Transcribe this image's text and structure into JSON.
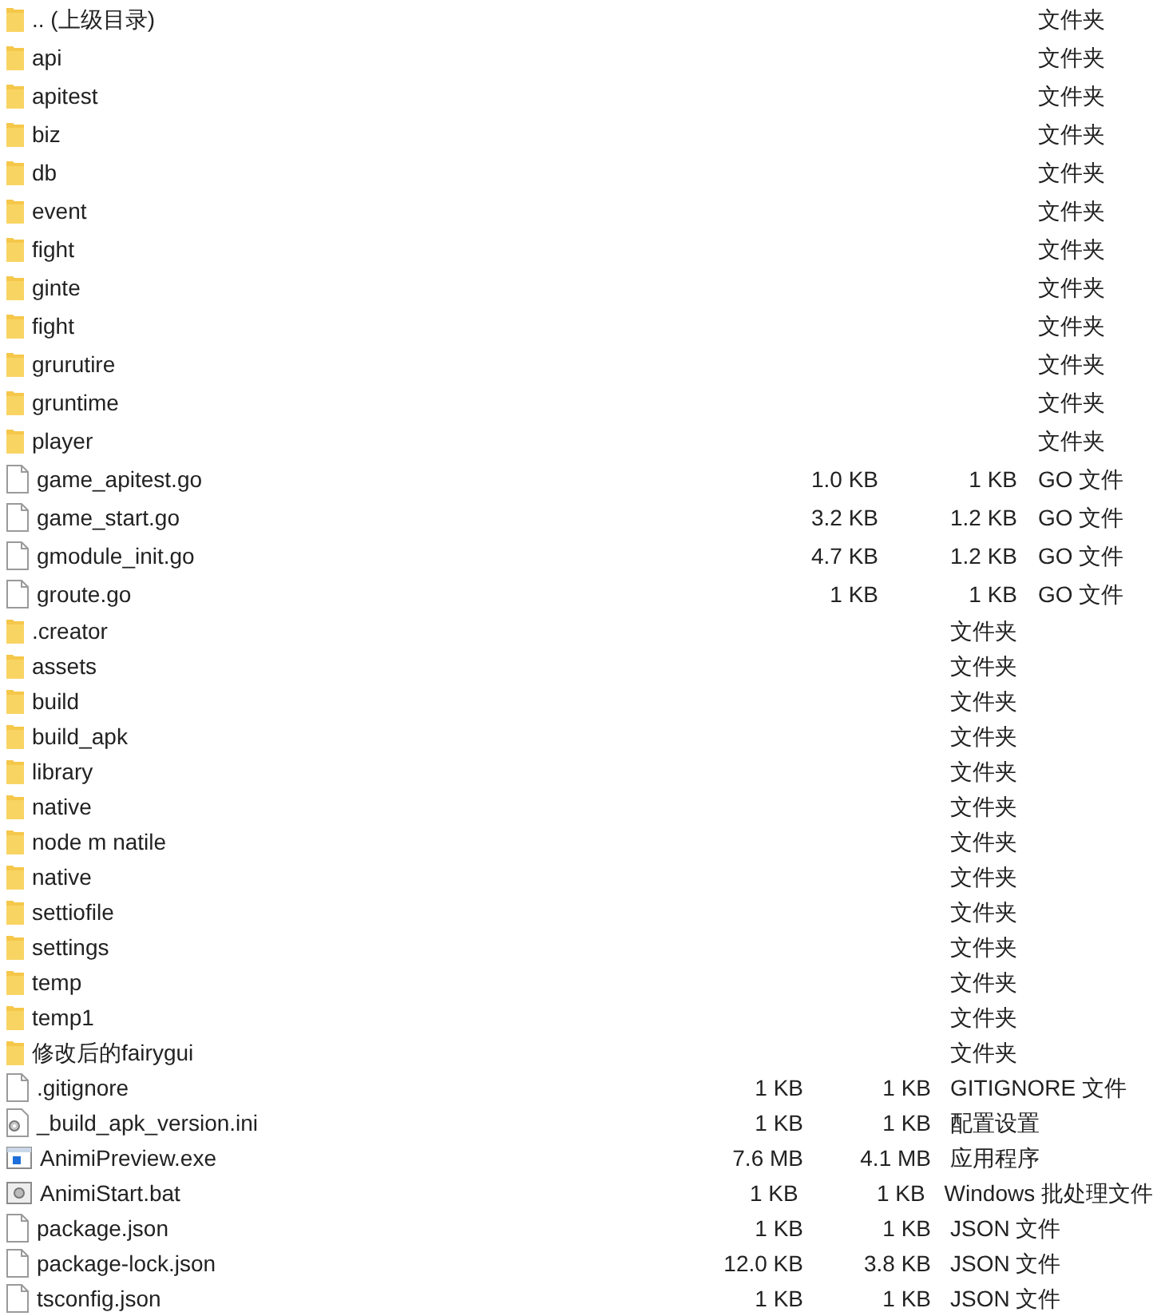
{
  "listings": [
    {
      "rows": [
        {
          "kind": "folder",
          "name": ".. (上级目录)",
          "size": "",
          "packed": "",
          "type": "文件夹"
        },
        {
          "kind": "folder",
          "name": "api",
          "type": "文件夹"
        },
        {
          "kind": "folder",
          "name": "apitest",
          "type": "文件夹"
        },
        {
          "kind": "folder",
          "name": "biz",
          "type": "文件夹"
        },
        {
          "kind": "folder",
          "name": "db",
          "type": "文件夹"
        },
        {
          "kind": "folder",
          "name": "event",
          "type": "文件夹"
        },
        {
          "kind": "folder",
          "name": "fight",
          "type": "文件夹"
        },
        {
          "kind": "folder",
          "name": "ginte",
          "type": "文件夹"
        },
        {
          "kind": "folder",
          "name": "fight",
          "type": "文件夹"
        },
        {
          "kind": "folder",
          "name": "grurutire",
          "type": "文件夹"
        },
        {
          "kind": "folder",
          "name": "gruntime",
          "type": "文件夹"
        },
        {
          "kind": "folder",
          "name": "player",
          "type": "文件夹"
        },
        {
          "kind": "file",
          "name": "game_apitest.go",
          "size": "1.0 KB",
          "packed": "1 KB",
          "type": "GO 文件"
        },
        {
          "kind": "file",
          "name": "game_start.go",
          "size": "3.2 KB",
          "packed": "1.2 KB",
          "type": "GO 文件"
        },
        {
          "kind": "file",
          "name": "gmodule_init.go",
          "size": "4.7 KB",
          "packed": "1.2 KB",
          "type": "GO 文件"
        },
        {
          "kind": "file",
          "name": "groute.go",
          "size": "1 KB",
          "packed": "1 KB",
          "type": "GO 文件"
        }
      ]
    },
    {
      "rows": [
        {
          "kind": "folder",
          "name": ".creator",
          "type": "文件夹"
        },
        {
          "kind": "folder",
          "name": "assets",
          "type": "文件夹"
        },
        {
          "kind": "folder",
          "name": "build",
          "type": "文件夹"
        },
        {
          "kind": "folder",
          "name": "build_apk",
          "type": "文件夹"
        },
        {
          "kind": "folder",
          "name": "library",
          "type": "文件夹"
        },
        {
          "kind": "folder",
          "name": "native",
          "type": "文件夹"
        },
        {
          "kind": "folder",
          "name": "node m natile",
          "type": "文件夹"
        },
        {
          "kind": "folder",
          "name": "native",
          "type": "文件夹"
        },
        {
          "kind": "folder",
          "name": "settiofile",
          "type": "文件夹"
        },
        {
          "kind": "folder",
          "name": "settings",
          "type": "文件夹"
        },
        {
          "kind": "folder",
          "name": "temp",
          "type": "文件夹"
        },
        {
          "kind": "folder",
          "name": "temp1",
          "type": "文件夹"
        },
        {
          "kind": "folder",
          "name": "修改后的fairygui",
          "type": "文件夹"
        },
        {
          "kind": "file",
          "name": ".gitignore",
          "size": "1 KB",
          "packed": "1 KB",
          "type": "GITIGNORE 文件"
        },
        {
          "kind": "ini",
          "name": "_build_apk_version.ini",
          "size": "1 KB",
          "packed": "1 KB",
          "type": "配置设置"
        },
        {
          "kind": "exe",
          "name": "AnimiPreview.exe",
          "size": "7.6 MB",
          "packed": "4.1 MB",
          "type": "应用程序"
        },
        {
          "kind": "bat",
          "name": "AnimiStart.bat",
          "size": "1 KB",
          "packed": "1 KB",
          "type": "Windows 批处理文件"
        },
        {
          "kind": "file",
          "name": "package.json",
          "size": "1 KB",
          "packed": "1 KB",
          "type": "JSON 文件"
        },
        {
          "kind": "file",
          "name": "package-lock.json",
          "size": "12.0 KB",
          "packed": "3.8 KB",
          "type": "JSON 文件"
        },
        {
          "kind": "file",
          "name": "tsconfig.json",
          "size": "1 KB",
          "packed": "1 KB",
          "type": "JSON 文件"
        }
      ]
    }
  ]
}
